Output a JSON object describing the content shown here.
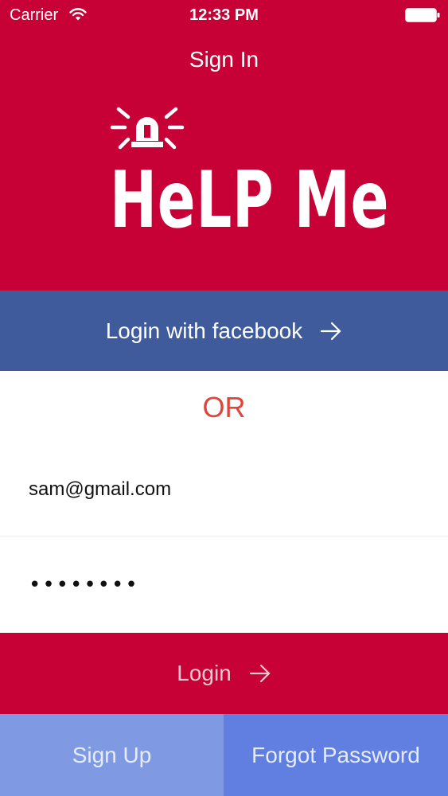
{
  "status_bar": {
    "carrier": "Carrier",
    "time": "12:33 PM",
    "wifi_icon": "wifi-icon",
    "battery_icon": "battery-icon"
  },
  "nav": {
    "title": "Sign In"
  },
  "logo": {
    "text": "HeLP Me",
    "icon": "siren-icon"
  },
  "facebook_button": {
    "label": "Login with facebook",
    "icon": "arrow-right-icon"
  },
  "divider": {
    "text": "OR"
  },
  "email_field": {
    "value": "sam@gmail.com"
  },
  "password_field": {
    "value": "sam12345"
  },
  "login_button": {
    "label": "Login",
    "icon": "arrow-right-icon"
  },
  "footer": {
    "sign_up_label": "Sign Up",
    "forgot_password_label": "Forgot Password"
  },
  "colors": {
    "brand_red": "#c70035",
    "facebook_blue": "#3f5b9c",
    "or_red": "#e0443a",
    "sign_up_blue": "#7f9ae3",
    "forgot_blue": "#607fe0"
  }
}
